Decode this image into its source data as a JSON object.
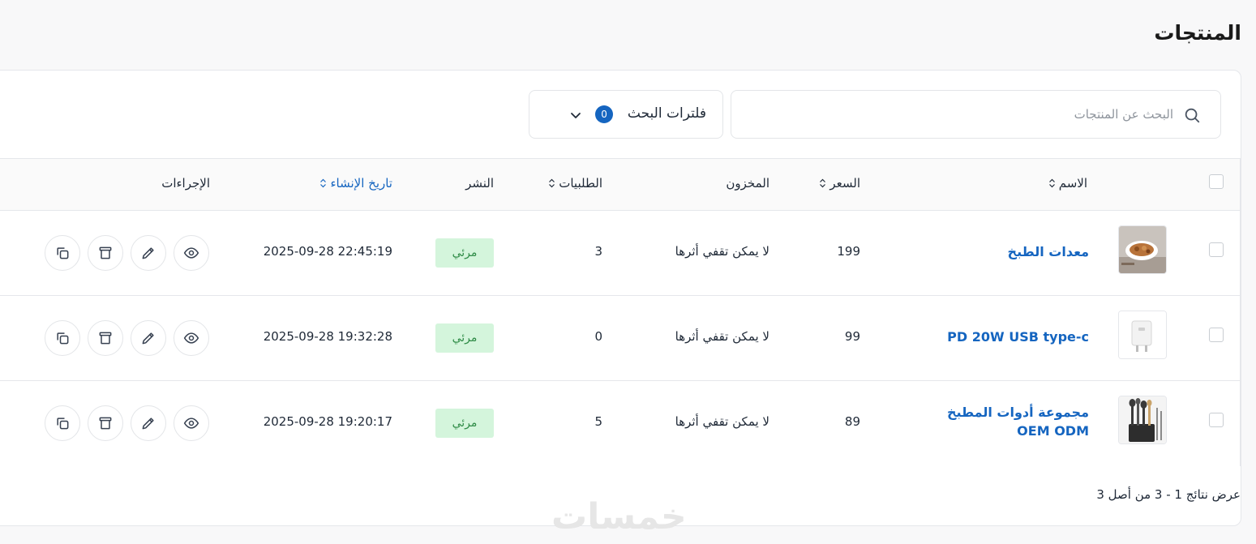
{
  "page": {
    "title": "المنتجات"
  },
  "search": {
    "placeholder": "البحث عن المنتجات",
    "value": ""
  },
  "filters": {
    "label": "فلترات البحث",
    "count": "0"
  },
  "table": {
    "headers": {
      "name": "الاسم",
      "price": "السعر",
      "stock": "المخزون",
      "orders": "الطلبيات",
      "publish": "النشر",
      "created": "تاريخ الإنشاء",
      "actions": "الإجراءات"
    },
    "rows": [
      {
        "name": "معدات الطبخ",
        "price": "199",
        "stock": "لا يمكن تقفي أثرها",
        "orders": "3",
        "publish": "مرئي",
        "created": "2025-09-28 22:45:19",
        "thumb": "kitchen-tools-photo"
      },
      {
        "name": "PD 20W USB type-c",
        "price": "99",
        "stock": "لا يمكن تقفي أثرها",
        "orders": "0",
        "publish": "مرئي",
        "created": "2025-09-28 19:32:28",
        "thumb": "usb-charger-photo"
      },
      {
        "name_line1": "مجموعة أدوات المطبخ",
        "name_line2": "OEM ODM",
        "price": "89",
        "stock": "لا يمكن تقفي أثرها",
        "orders": "5",
        "publish": "مرئي",
        "created": "2025-09-28 19:20:17",
        "thumb": "utensil-set-photo"
      }
    ]
  },
  "footer": {
    "results_text": "عرض نتائج 1 - 3 من أصل 3"
  },
  "watermark": "خمسات",
  "colors": {
    "accent": "#1565c0",
    "badge_bg": "#d4f5dc",
    "badge_text": "#2e8b46",
    "border": "#e5e7eb"
  },
  "icons": [
    "search-icon",
    "chevron-down-icon",
    "sort-icon",
    "eye-icon",
    "pencil-icon",
    "trash-icon",
    "copy-icon"
  ]
}
